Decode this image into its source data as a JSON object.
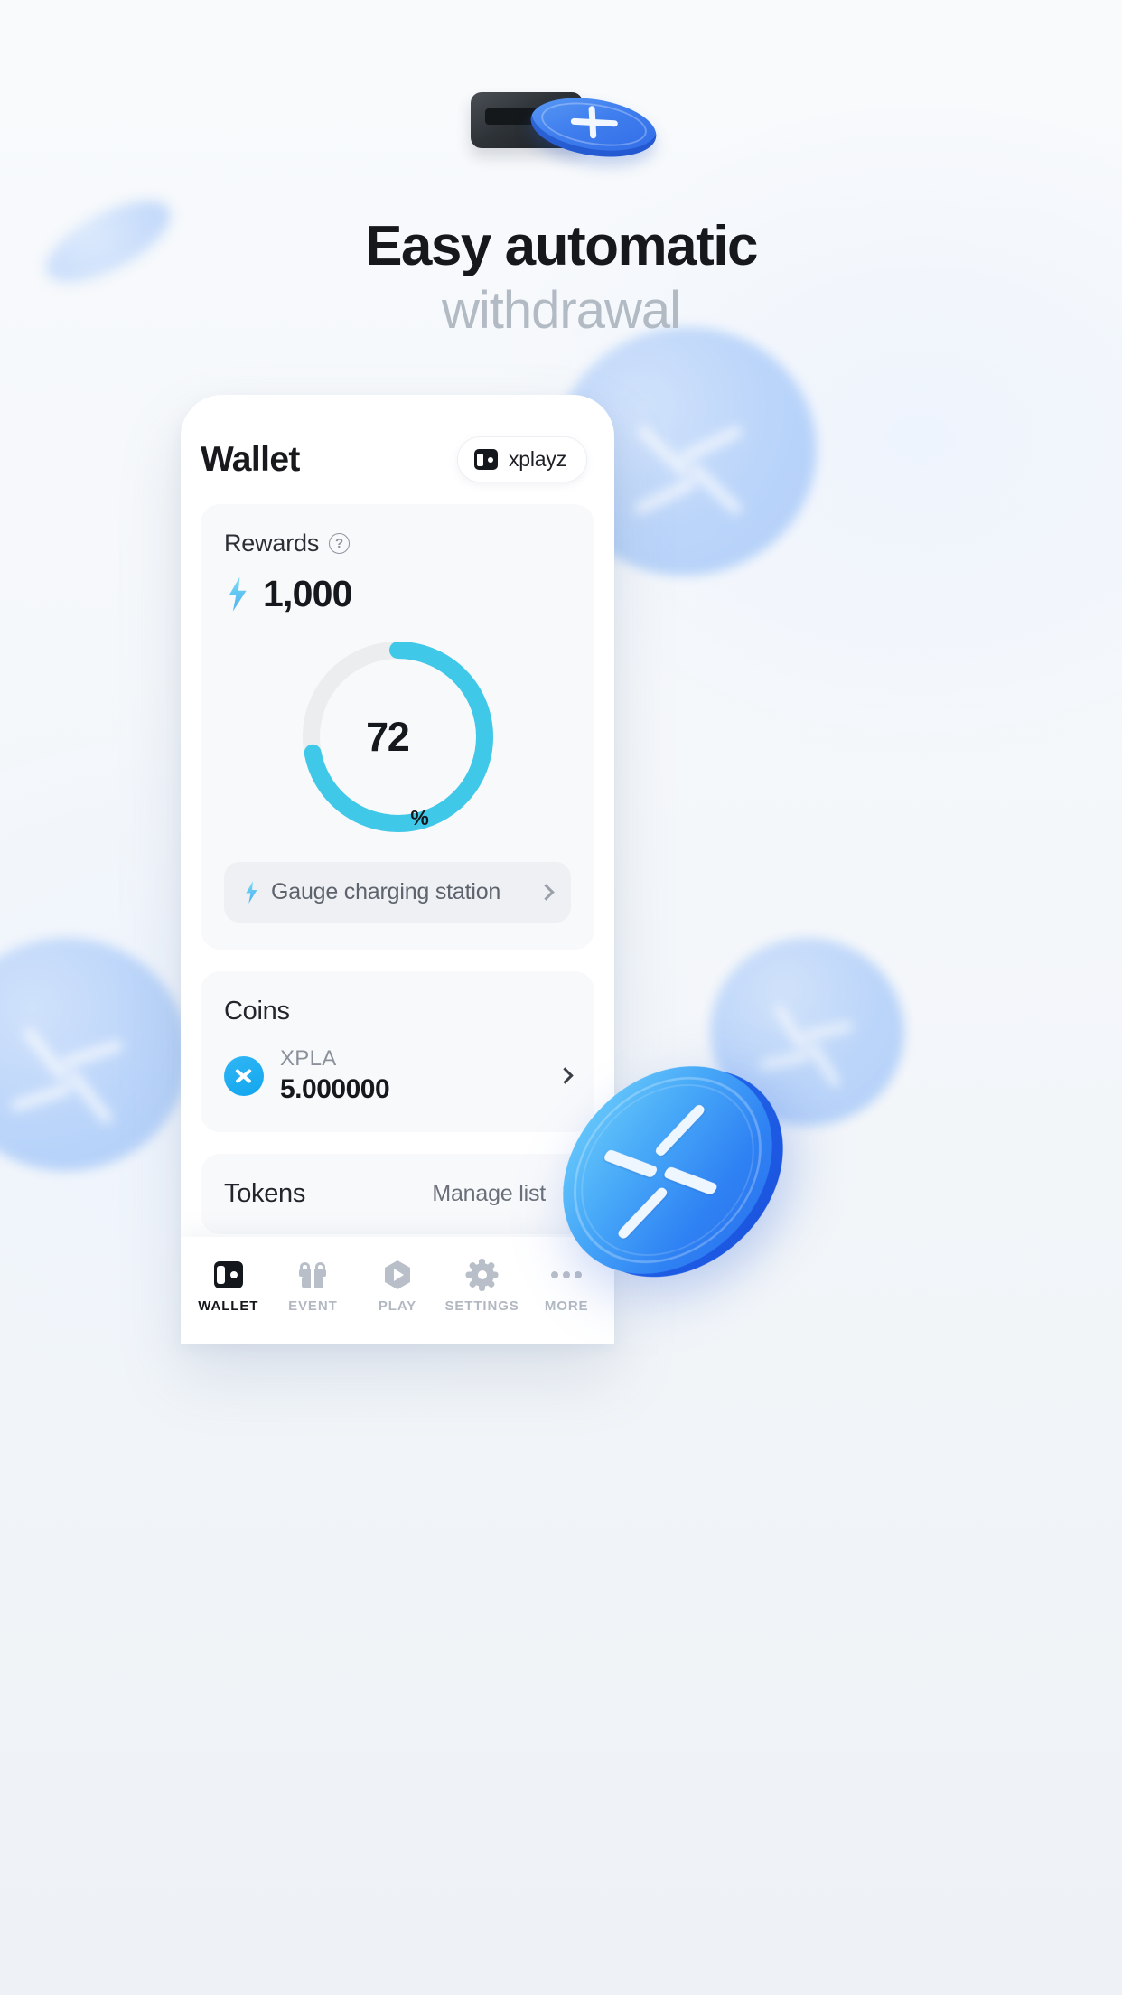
{
  "hero": {
    "title": "Easy automatic",
    "subtitle": "withdrawal",
    "icon": "atm-coin-dispense-icon"
  },
  "phone": {
    "header": {
      "title": "Wallet",
      "wallet_chip": {
        "icon": "wallet-icon",
        "label": "xplayz"
      }
    },
    "rewards": {
      "title": "Rewards",
      "help_icon": "question-mark-icon",
      "bolt_icon": "lightning-bolt-icon",
      "amount": "1,000",
      "gauge": {
        "value": 72,
        "value_text": "72",
        "unit": "%",
        "track_color": "#ecedef",
        "fill_color": "#3fc8e8"
      },
      "charge_row": {
        "icon": "lightning-bolt-icon",
        "label": "Gauge charging station",
        "chevron": "chevron-right-icon"
      }
    },
    "coins": {
      "title": "Coins",
      "items": [
        {
          "icon": "xpla-coin-icon",
          "symbol": "XPLA",
          "balance": "5.000000",
          "chevron": "chevron-right-icon"
        }
      ]
    },
    "tokens": {
      "title": "Tokens",
      "manage_label": "Manage list",
      "chevron": "chevron-right-icon"
    },
    "tabbar": {
      "items": [
        {
          "label": "WALLET",
          "icon": "wallet-icon",
          "active": true
        },
        {
          "label": "EVENT",
          "icon": "gift-icon",
          "active": false
        },
        {
          "label": "PLAY",
          "icon": "play-hexagon-icon",
          "active": false
        },
        {
          "label": "SETTINGS",
          "icon": "gear-icon",
          "active": false
        },
        {
          "label": "MORE",
          "icon": "ellipsis-icon",
          "active": false
        }
      ]
    }
  },
  "decor": {
    "big_coin_icon": "xpla-coin-3d-icon",
    "background_coins": 4
  },
  "colors": {
    "accent_cyan": "#3fc8e8",
    "accent_blue": "#2f82f3",
    "text_primary": "#15181c",
    "text_muted": "#b2bac4",
    "background": "#f7f9fb"
  }
}
